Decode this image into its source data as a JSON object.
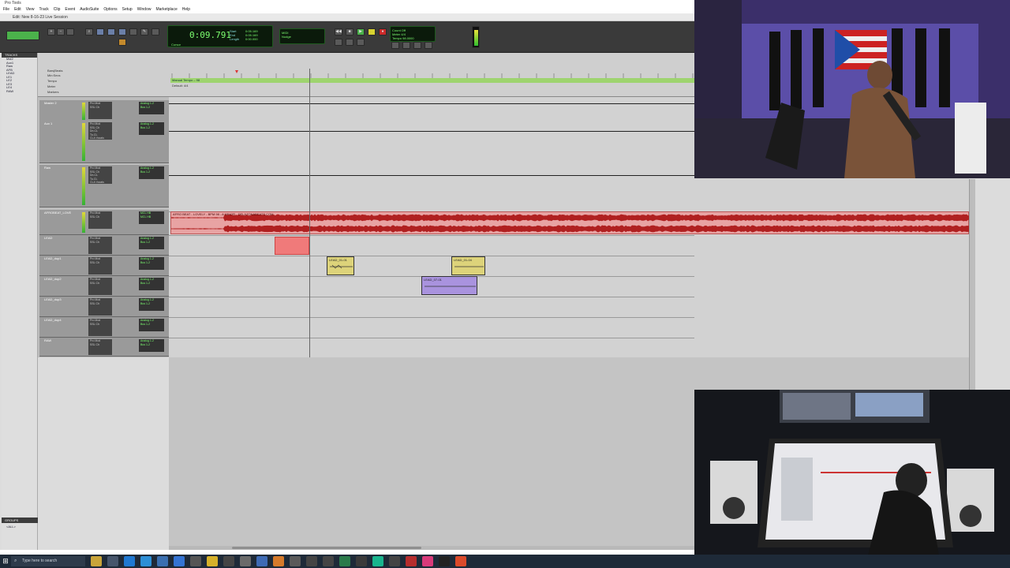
{
  "window": {
    "app_title": "Pro Tools",
    "edit_title": "Edit: New 8-16-23 Live Session"
  },
  "menu": [
    "File",
    "Edit",
    "View",
    "Track",
    "Clip",
    "Event",
    "AudioSuite",
    "Options",
    "Setup",
    "Window",
    "Marketplace",
    "Help"
  ],
  "counter": {
    "main": "0:09.791",
    "labels": [
      "Start",
      "End",
      "Length"
    ],
    "values": [
      "0:05.169",
      "0:05.169",
      "0:00.000"
    ],
    "sub": "Cursor"
  },
  "transport": {
    "count_off": "Count Off",
    "meter": "Meter",
    "tempo": "Tempo",
    "tempo_value": "98.0000",
    "meter_value": "4/4",
    "midi": "MIDI",
    "nudge": "Nudge"
  },
  "tracks_panel": {
    "header": "TRACKS",
    "items": [
      "Mst2",
      "Aux1",
      "Raw",
      "AFB",
      "LEAD",
      "LE1",
      "LE2",
      "LE3",
      "LE4",
      "RAW"
    ],
    "groups_header": "GROUPS",
    "groups_item": "<ALL>"
  },
  "rulers": {
    "labels": [
      "Bars|Beats",
      "Min:Secs",
      "Tempo",
      "Meter",
      "Markers"
    ],
    "tempo_text": "Manual Tempo – 98",
    "meter_text": "Default: 4/4"
  },
  "tracks": [
    {
      "name": "Master 2",
      "color": "#6b2f2f"
    },
    {
      "name": "Aux 1",
      "color": "#2d7a2d"
    },
    {
      "name": "Raw",
      "color": "#2d7a2d"
    },
    {
      "name": "AFROBEAT_LOVE",
      "color": "#c14444"
    },
    {
      "name": "LEAD",
      "color": "#c14444"
    },
    {
      "name": "LEAD_dup1",
      "color": "#2a4f8f"
    },
    {
      "name": "LEAD_dup2",
      "color": "#2a4f8f"
    },
    {
      "name": "LEAD_dup3",
      "color": "#2a4f8f"
    },
    {
      "name": "LEAD_dup4",
      "color": "#2a4f8f"
    },
    {
      "name": "RAW",
      "color": "#2a4f8f"
    }
  ],
  "inserts": [
    "Pro Mod",
    "SSL Ch",
    "Dn.CL",
    "Tu.CL",
    "CLA Vocals"
  ],
  "io": [
    "Analog 1-2",
    "Bus 1-2",
    "MCL HB"
  ],
  "clips": {
    "audio_label": "AFRO BEAT - LOVELY - BPM 98 - A MINOR - DELAZONABEATS.COM",
    "y1_label": "LEAD_01-01",
    "y2_label": "LEAD_01-04",
    "p1_label": "LEAD_07-01"
  },
  "taskbar": {
    "search_placeholder": "Type here to search"
  },
  "colors": {
    "audio_clip": "#e8a3a3",
    "waveform": "#b02020",
    "counter_green": "#7dff70",
    "tempo_ruler": "#9ed46f"
  }
}
